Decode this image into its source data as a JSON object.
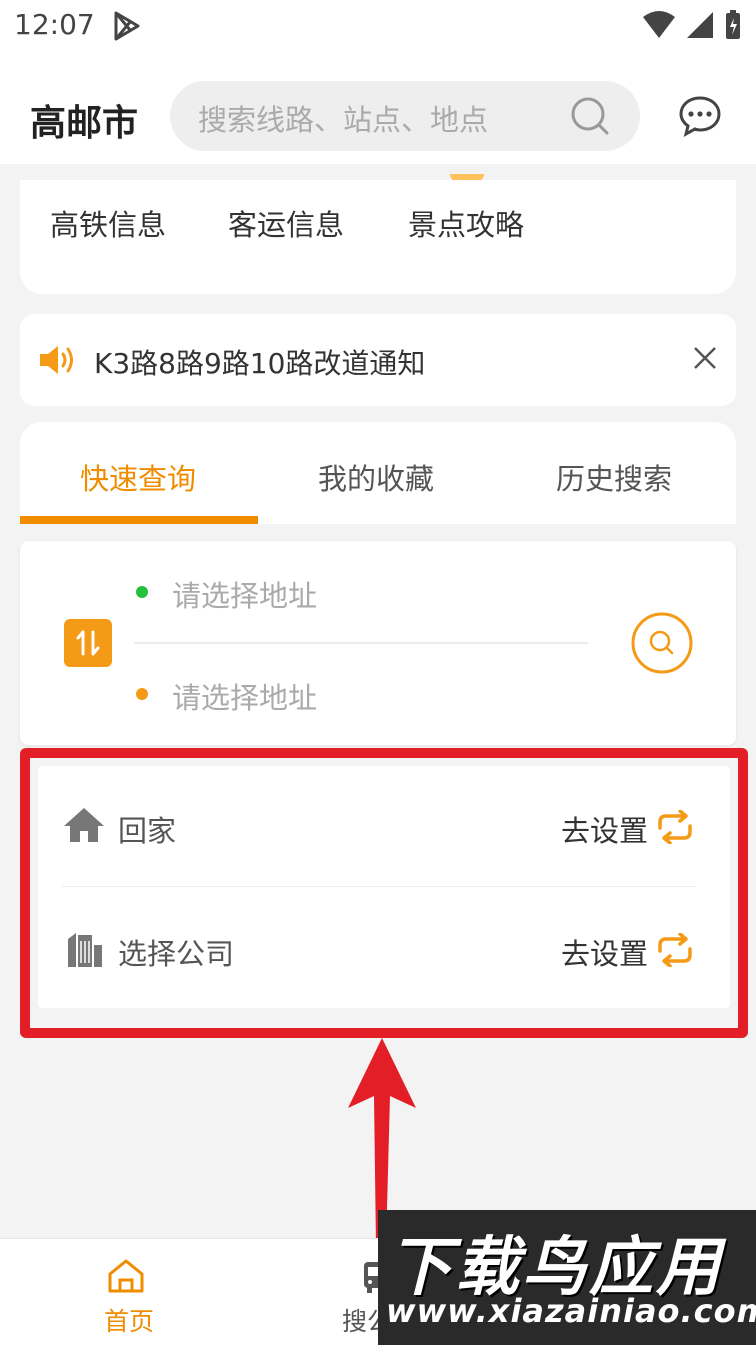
{
  "status_bar": {
    "time": "12:07"
  },
  "header": {
    "city": "高邮市",
    "search_placeholder": "搜索线路、站点、地点"
  },
  "quick_links": [
    "高铁信息",
    "客运信息",
    "景点攻略"
  ],
  "notice": {
    "text": "K3路8路9路10路改道通知"
  },
  "tabs": [
    {
      "label": "快速查询",
      "active": true
    },
    {
      "label": "我的收藏",
      "active": false
    },
    {
      "label": "历史搜索",
      "active": false
    }
  ],
  "route": {
    "start_placeholder": "请选择地址",
    "end_placeholder": "请选择地址"
  },
  "shortcuts": [
    {
      "label": "回家",
      "action": "去设置",
      "icon": "home-icon"
    },
    {
      "label": "选择公司",
      "action": "去设置",
      "icon": "building-icon"
    }
  ],
  "bottom_nav": [
    {
      "label": "首页",
      "active": true,
      "icon": "home-outline-icon"
    },
    {
      "label": "搜公",
      "active": false,
      "icon": "bus-icon"
    }
  ],
  "watermark": {
    "big": "下载鸟应用",
    "small": "www.xiazainiao.com"
  },
  "colors": {
    "accent": "#f08c00",
    "highlight": "#e41e26",
    "start_dot": "#22c33a",
    "end_dot": "#f59a16"
  }
}
